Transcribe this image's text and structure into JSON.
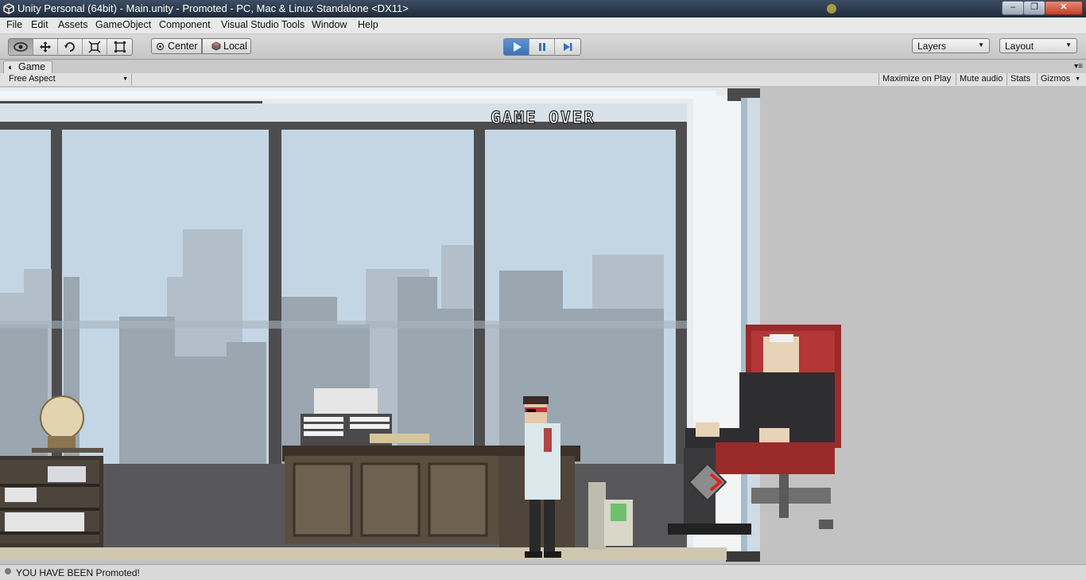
{
  "window": {
    "title": "Unity Personal (64bit) - Main.unity - Promoted - PC, Mac & Linux Standalone <DX11>",
    "controls": {
      "minimize": "–",
      "maximize": "❐",
      "close": "✕"
    }
  },
  "menu": [
    "File",
    "Edit",
    "Assets",
    "GameObject",
    "Component",
    "Visual Studio Tools",
    "Window",
    "Help"
  ],
  "toolbar": {
    "tools": [
      "view-hand-icon",
      "move-icon",
      "rotate-icon",
      "scale-icon",
      "rect-tool-icon"
    ],
    "active_tool": "view-hand-icon",
    "pivot_mode": "Center",
    "pivot_rotation": "Local",
    "play_state": "playing",
    "layers_label": "Layers",
    "layout_label": "Layout"
  },
  "game_view": {
    "tab_label": "Game",
    "aspect": "Free Aspect",
    "buttons": [
      "Maximize on Play",
      "Mute audio",
      "Stats",
      "Gizmos"
    ],
    "overlay_text": "GAME OVER"
  },
  "status_bar": {
    "message": "YOU HAVE BEEN Promoted!"
  },
  "colors": {
    "play_active": "#4a82c8",
    "chair_red": "#9b2a2a",
    "sky": "#c4d6e4"
  }
}
